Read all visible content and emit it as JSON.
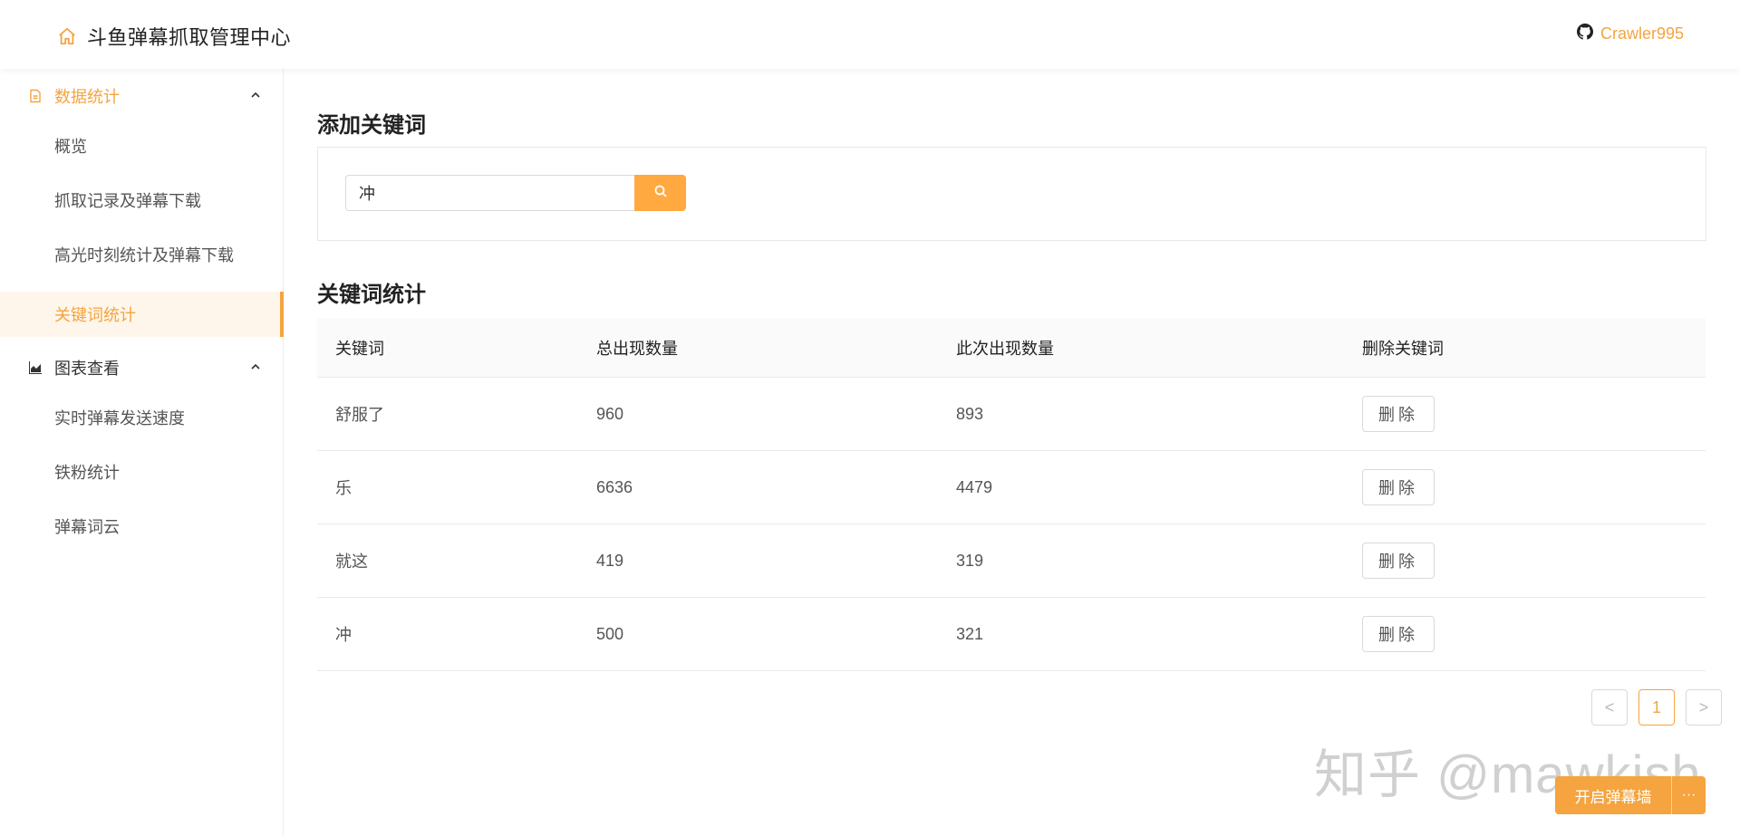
{
  "header": {
    "title": "斗鱼弹幕抓取管理中心",
    "github_label": "Crawler995"
  },
  "sidebar": {
    "groups": [
      {
        "label": "数据统计",
        "items": [
          {
            "label": "概览"
          },
          {
            "label": "抓取记录及弹幕下载"
          },
          {
            "label": "高光时刻统计及弹幕下载"
          },
          {
            "label": "关键词统计"
          }
        ]
      },
      {
        "label": "图表查看",
        "items": [
          {
            "label": "实时弹幕发送速度"
          },
          {
            "label": "铁粉统计"
          },
          {
            "label": "弹幕词云"
          }
        ]
      }
    ]
  },
  "main": {
    "add_title": "添加关键词",
    "search_value": "冲",
    "stats_title": "关键词统计",
    "columns": [
      "关键词",
      "总出现数量",
      "此次出现数量",
      "删除关键词"
    ],
    "rows": [
      {
        "keyword": "舒服了",
        "total": "960",
        "current": "893",
        "action": "删除"
      },
      {
        "keyword": "乐",
        "total": "6636",
        "current": "4479",
        "action": "删除"
      },
      {
        "keyword": "就这",
        "total": "419",
        "current": "319",
        "action": "删除"
      },
      {
        "keyword": "冲",
        "total": "500",
        "current": "321",
        "action": "删除"
      }
    ],
    "pagination": {
      "prev": "<",
      "current": "1",
      "next": ">"
    }
  },
  "watermark": "知乎 @mawkish",
  "float_button": {
    "label": "开启弹幕墙",
    "more": "···"
  },
  "colors": {
    "accent": "#f5a43f",
    "selected_bg": "#fef6ea"
  }
}
